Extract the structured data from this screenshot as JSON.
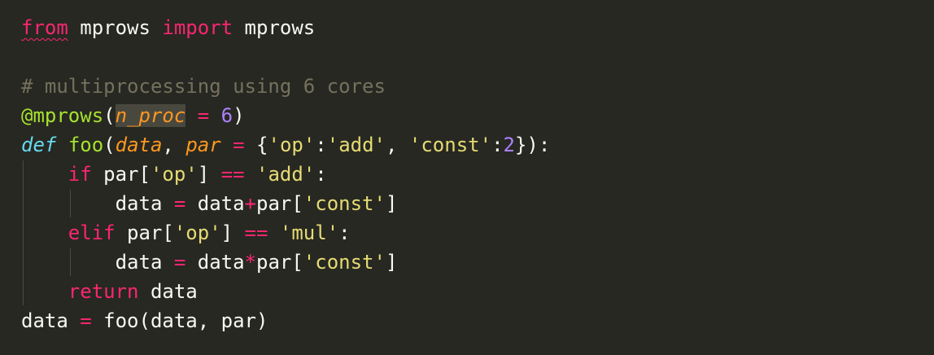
{
  "editor": {
    "colors": {
      "background": "#272822",
      "keyword": "#f92672",
      "storage": "#66d9ef",
      "function": "#a6e22e",
      "parameter": "#fd971f",
      "number": "#ae81ff",
      "string": "#e6db74",
      "comment": "#75715e",
      "text": "#f8f8f2"
    },
    "lines": [
      {
        "tokens": [
          {
            "text": "from",
            "cls": "kw squiggle"
          },
          {
            "text": " mprows ",
            "cls": "plain"
          },
          {
            "text": "import",
            "cls": "kw"
          },
          {
            "text": " mprows",
            "cls": "plain"
          }
        ]
      },
      {
        "tokens": []
      },
      {
        "tokens": [
          {
            "text": "# multiprocessing using 6 cores",
            "cls": "cmt"
          }
        ]
      },
      {
        "tokens": [
          {
            "text": "@mprows",
            "cls": "fn"
          },
          {
            "text": "(",
            "cls": "plain"
          },
          {
            "text": "n_proc",
            "cls": "param highlight"
          },
          {
            "text": " ",
            "cls": "plain"
          },
          {
            "text": "=",
            "cls": "op"
          },
          {
            "text": " ",
            "cls": "plain"
          },
          {
            "text": "6",
            "cls": "num"
          },
          {
            "text": ")",
            "cls": "plain"
          }
        ]
      },
      {
        "tokens": [
          {
            "text": "def",
            "cls": "defkw"
          },
          {
            "text": " ",
            "cls": "plain"
          },
          {
            "text": "foo",
            "cls": "fn"
          },
          {
            "text": "(",
            "cls": "plain"
          },
          {
            "text": "data",
            "cls": "param"
          },
          {
            "text": ", ",
            "cls": "plain"
          },
          {
            "text": "par",
            "cls": "param"
          },
          {
            "text": " ",
            "cls": "plain"
          },
          {
            "text": "=",
            "cls": "op"
          },
          {
            "text": " {",
            "cls": "plain"
          },
          {
            "text": "'op'",
            "cls": "str"
          },
          {
            "text": ":",
            "cls": "plain"
          },
          {
            "text": "'add'",
            "cls": "str"
          },
          {
            "text": ", ",
            "cls": "plain"
          },
          {
            "text": "'const'",
            "cls": "str"
          },
          {
            "text": ":",
            "cls": "plain"
          },
          {
            "text": "2",
            "cls": "num"
          },
          {
            "text": "}):",
            "cls": "plain"
          }
        ]
      },
      {
        "tokens": [
          {
            "text": "    ",
            "cls": "plain"
          },
          {
            "text": "if",
            "cls": "kw"
          },
          {
            "text": " par[",
            "cls": "plain"
          },
          {
            "text": "'op'",
            "cls": "str"
          },
          {
            "text": "] ",
            "cls": "plain"
          },
          {
            "text": "==",
            "cls": "op"
          },
          {
            "text": " ",
            "cls": "plain"
          },
          {
            "text": "'add'",
            "cls": "str"
          },
          {
            "text": ":",
            "cls": "plain"
          }
        ]
      },
      {
        "tokens": [
          {
            "text": "        data ",
            "cls": "plain"
          },
          {
            "text": "=",
            "cls": "op"
          },
          {
            "text": " data",
            "cls": "plain"
          },
          {
            "text": "+",
            "cls": "op"
          },
          {
            "text": "par[",
            "cls": "plain"
          },
          {
            "text": "'const'",
            "cls": "str"
          },
          {
            "text": "]",
            "cls": "plain"
          }
        ]
      },
      {
        "tokens": [
          {
            "text": "    ",
            "cls": "plain"
          },
          {
            "text": "elif",
            "cls": "kw"
          },
          {
            "text": " par[",
            "cls": "plain"
          },
          {
            "text": "'op'",
            "cls": "str"
          },
          {
            "text": "] ",
            "cls": "plain"
          },
          {
            "text": "==",
            "cls": "op"
          },
          {
            "text": " ",
            "cls": "plain"
          },
          {
            "text": "'mul'",
            "cls": "str"
          },
          {
            "text": ":",
            "cls": "plain"
          }
        ]
      },
      {
        "tokens": [
          {
            "text": "        data ",
            "cls": "plain"
          },
          {
            "text": "=",
            "cls": "op"
          },
          {
            "text": " data",
            "cls": "plain"
          },
          {
            "text": "*",
            "cls": "op"
          },
          {
            "text": "par[",
            "cls": "plain"
          },
          {
            "text": "'const'",
            "cls": "str"
          },
          {
            "text": "]",
            "cls": "plain"
          }
        ]
      },
      {
        "tokens": [
          {
            "text": "    ",
            "cls": "plain"
          },
          {
            "text": "return",
            "cls": "kw"
          },
          {
            "text": " data",
            "cls": "plain"
          }
        ]
      },
      {
        "tokens": [
          {
            "text": "data ",
            "cls": "plain"
          },
          {
            "text": "=",
            "cls": "op"
          },
          {
            "text": " foo(data, par)",
            "cls": "plain"
          }
        ]
      }
    ]
  }
}
